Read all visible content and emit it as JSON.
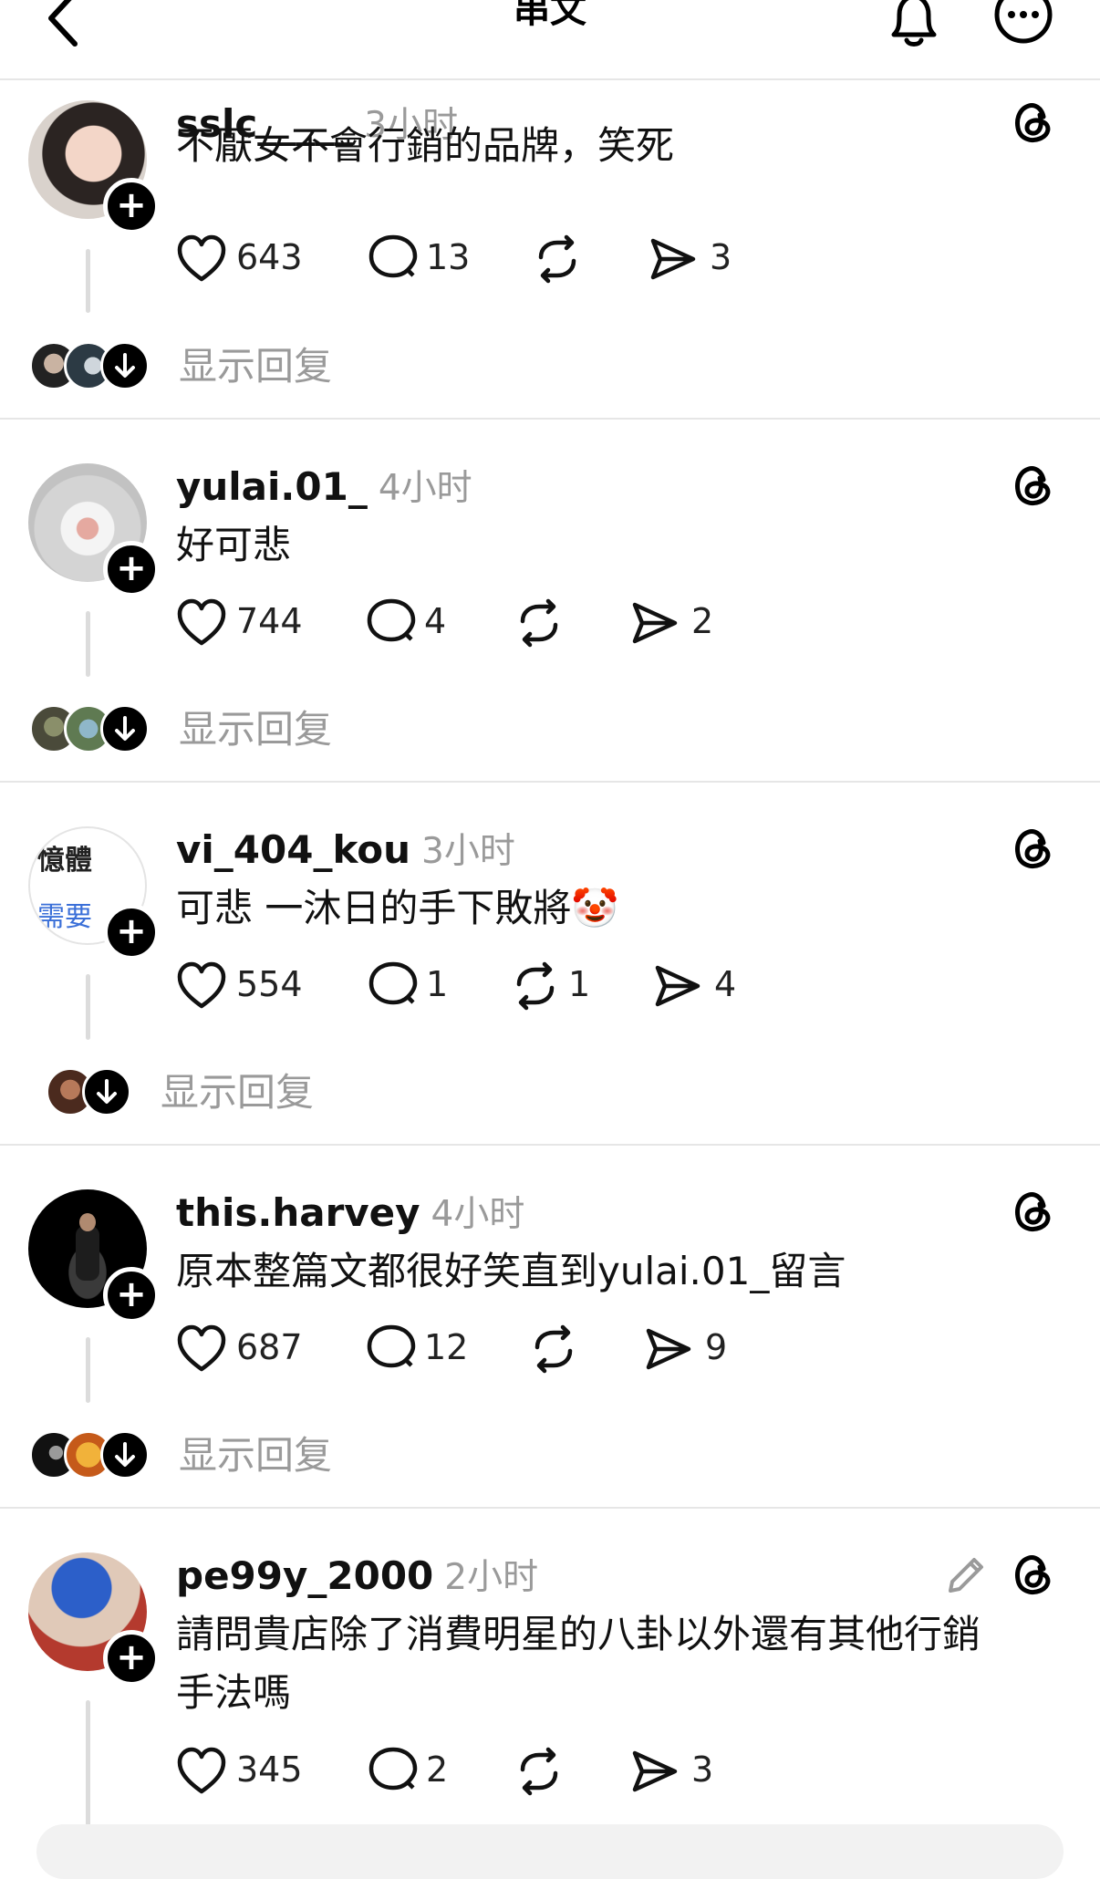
{
  "topbar": {
    "title": "串文"
  },
  "posts": [
    {
      "username": "sslc_____",
      "time": "3小时",
      "text": "不厭女不會行銷的品牌，笑死",
      "likes": "643",
      "comments": "13",
      "reposts": "",
      "shares": "3",
      "show_replies": "显示回复"
    },
    {
      "username": "yulai.01_",
      "time": "4小时",
      "text": "好可悲",
      "likes": "744",
      "comments": "4",
      "reposts": "",
      "shares": "2",
      "show_replies": "显示回复"
    },
    {
      "username": "vi_404_kou",
      "time": "3小时",
      "text": "可悲 一沐日的手下敗將",
      "emoji": "🤡",
      "avatar_text_1": "憶體",
      "avatar_text_2": "需要",
      "likes": "554",
      "comments": "1",
      "reposts": "1",
      "shares": "4",
      "show_replies": "显示回复"
    },
    {
      "username": "this.harvey",
      "time": "4小时",
      "text": "原本整篇文都很好笑直到yulai.01_留言",
      "likes": "687",
      "comments": "12",
      "reposts": "",
      "shares": "9",
      "show_replies": "显示回复"
    },
    {
      "username": "pe99y_2000",
      "time": "2小时",
      "text_line1": "請問貴店除了消費明星的八卦以外還有其他行銷",
      "text_line2": "手法嗎",
      "likes": "345",
      "comments": "2",
      "reposts": "",
      "shares": "3"
    }
  ],
  "colors": {
    "accent": "#000000",
    "muted": "#9a9a9a",
    "divider": "#e6e6e6"
  }
}
